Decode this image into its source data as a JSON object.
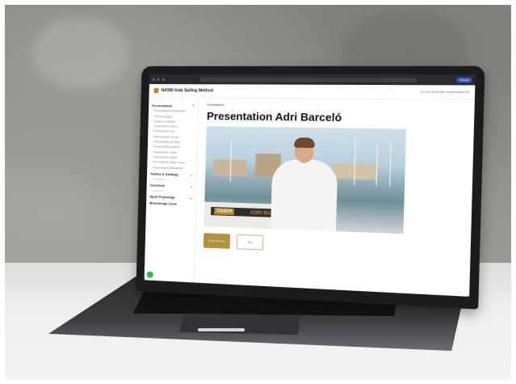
{
  "browser": {
    "url": "",
    "action_label": "Tutorial"
  },
  "app": {
    "title": "NASW Inda Sailing Method",
    "header_right": "0% 76 Lecciones completadas 0/0"
  },
  "sidebar": {
    "sections": [
      {
        "label": "Presentación",
        "items": [
          "Presentación Adri Barceló",
          "Foto de regata",
          "Equipo y material",
          "Presentación barco",
          "Presentación foto",
          "Instrucciones de uso",
          "Presentación jornada",
          "Presentación equipos",
          "Presentación Delta",
          "Presentación Bases",
          "Presentación Sobre Grupo",
          "Presentación Bibliografia"
        ]
      },
      {
        "label": "Táctica & Strategy",
        "sub": "4 Lecciones"
      },
      {
        "label": "Technical",
        "sub": "Lecciones"
      },
      {
        "label": "Sport Psycology",
        "sub": ""
      },
      {
        "label": "Metodology Cycle",
        "sub": ""
      }
    ]
  },
  "main": {
    "breadcrumb": "Presentación",
    "title": "Presentation Adri Barceló",
    "photo_labels": {
      "coach": "COACH",
      "name": "ADRI BARCELÓ"
    },
    "primary_button": "Entrar al curso",
    "secondary_button": "Test"
  },
  "colors": {
    "accent": "#b3913f",
    "green_fab": "#2db84b"
  }
}
